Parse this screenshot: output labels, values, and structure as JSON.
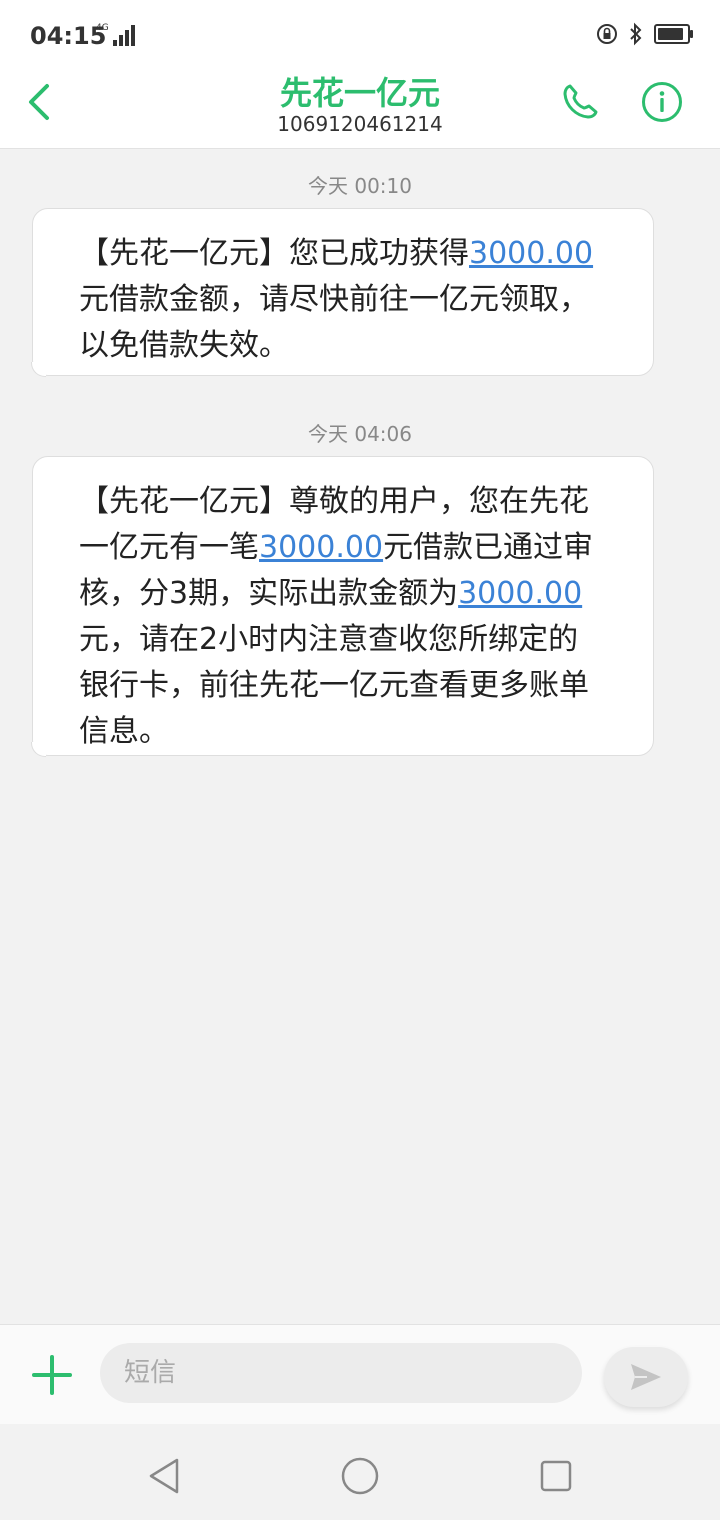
{
  "status": {
    "time": "04:15",
    "network": "4G",
    "battery_level": 0.9
  },
  "header": {
    "title": "先花一亿元",
    "phone_number": "1069120461214",
    "accent_color": "#2cbd6e"
  },
  "messages": [
    {
      "timestamp": "今天 00:10",
      "parts": [
        "【先花一亿元】您已成功获得",
        "3000.00",
        "元借款金额，请尽快前往一亿元领取，以免借款失效。"
      ]
    },
    {
      "timestamp": "今天 04:06",
      "parts": [
        "【先花一亿元】尊敬的用户，您在先花一亿元有一笔",
        "3000.00",
        "元借款已通过审核，分3期，实际出款金额为",
        "3000.00",
        "元，请在2小时内注意查收您所绑定的银行卡，前往先花一亿元查看更多账单信息。"
      ]
    }
  ],
  "composer": {
    "placeholder": "短信",
    "value": ""
  },
  "icons": {
    "back": "back-chevron-icon",
    "call": "phone-icon",
    "info": "info-icon",
    "add": "plus-icon",
    "send": "send-icon",
    "nav_back": "triangle-back-icon",
    "nav_home": "circle-home-icon",
    "nav_recents": "square-recents-icon"
  }
}
